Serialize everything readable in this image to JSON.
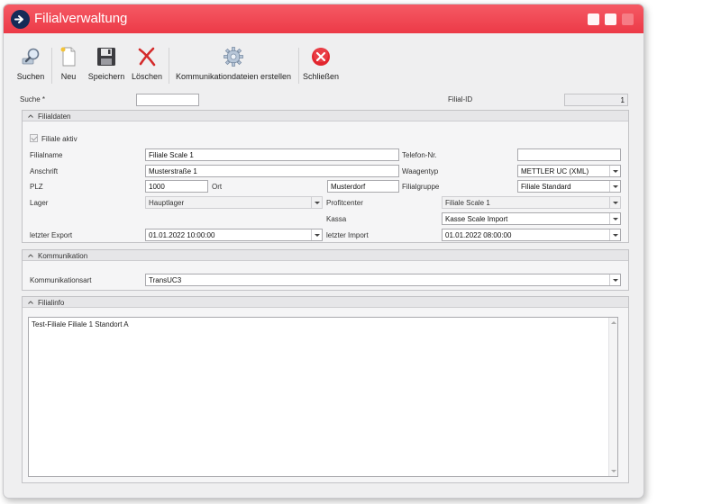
{
  "window": {
    "title": "Filialverwaltung"
  },
  "toolbar": {
    "search_label": "Suchen",
    "new_label": "Neu",
    "save_label": "Speichern",
    "delete_label": "Löschen",
    "comm_files_label": "Kommunikationdateien erstellen",
    "close_label": "Schließen"
  },
  "search": {
    "label": "Suche *",
    "value": ""
  },
  "filial_id": {
    "label": "Filial-ID",
    "value": "1"
  },
  "filialdaten": {
    "header": "Filialdaten",
    "active_label": "Filiale aktiv",
    "active_checked": true,
    "name_label": "Filialname",
    "name_value": "Filiale Scale 1",
    "phone_label": "Telefon-Nr.",
    "phone_value": "",
    "address_label": "Anschrift",
    "address_value": "Musterstraße 1",
    "scale_type_label": "Waagentyp",
    "scale_type_value": "METTLER UC (XML)",
    "plz_label": "PLZ",
    "plz_value": "1000",
    "city_label": "Ort",
    "city_value": "Musterdorf",
    "group_label": "Filialgruppe",
    "group_value": "Filiale Standard",
    "warehouse_label": "Lager",
    "warehouse_value": "Hauptlager",
    "profitcenter_label": "Profitcenter",
    "profitcenter_value": "Filiale Scale 1",
    "register_label": "Kassa",
    "register_value": "Kasse Scale Import",
    "last_export_label": "letzter Export",
    "last_export_value": "01.01.2022 10:00:00",
    "last_import_label": "letzter Import",
    "last_import_value": "01.01.2022 08:00:00"
  },
  "kommunikation": {
    "header": "Kommunikation",
    "type_label": "Kommunikationsart",
    "type_value": "TransUC3"
  },
  "filialinfo": {
    "header": "Filialinfo",
    "text": "Test-Filiale Filiale 1 Standort A"
  }
}
